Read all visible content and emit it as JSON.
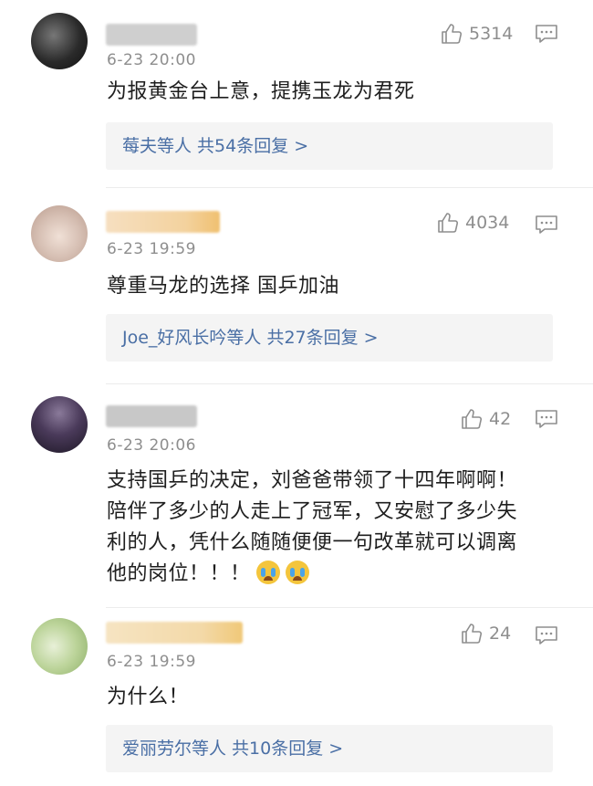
{
  "comments": [
    {
      "time": "6-23 20:00",
      "likes": "5314",
      "text": "为报黄金台上意，提携玉龙为君死",
      "replies": "莓夫等人 共54条回复 >",
      "avatar_color": "#3a3a3a",
      "name_color": "#c9c9c9"
    },
    {
      "time": "6-23 19:59",
      "likes": "4034",
      "text": "尊重马龙的选择 国乒加油",
      "replies": "Joe_好风长吟等人 共27条回复 >",
      "avatar_color": "#d9c7bf",
      "name_color": "#f2d3a6"
    },
    {
      "time": "6-23 20:06",
      "likes": "42",
      "text": "支持国乒的决定，刘爸爸带领了十四年啊啊！陪伴了多少的人走上了冠军，又安慰了多少失利的人，凭什么随随便便一句改革就可以调离他的岗位！！！",
      "avatar_color": "#3d2f4a",
      "name_color": "#c4c4c4"
    },
    {
      "time": "6-23 19:59",
      "likes": "24",
      "text": "为什么！",
      "replies": "爱丽劳尔等人 共10条回复 >",
      "avatar_color": "#c9d9b0",
      "name_color": "#f2dcae"
    }
  ]
}
